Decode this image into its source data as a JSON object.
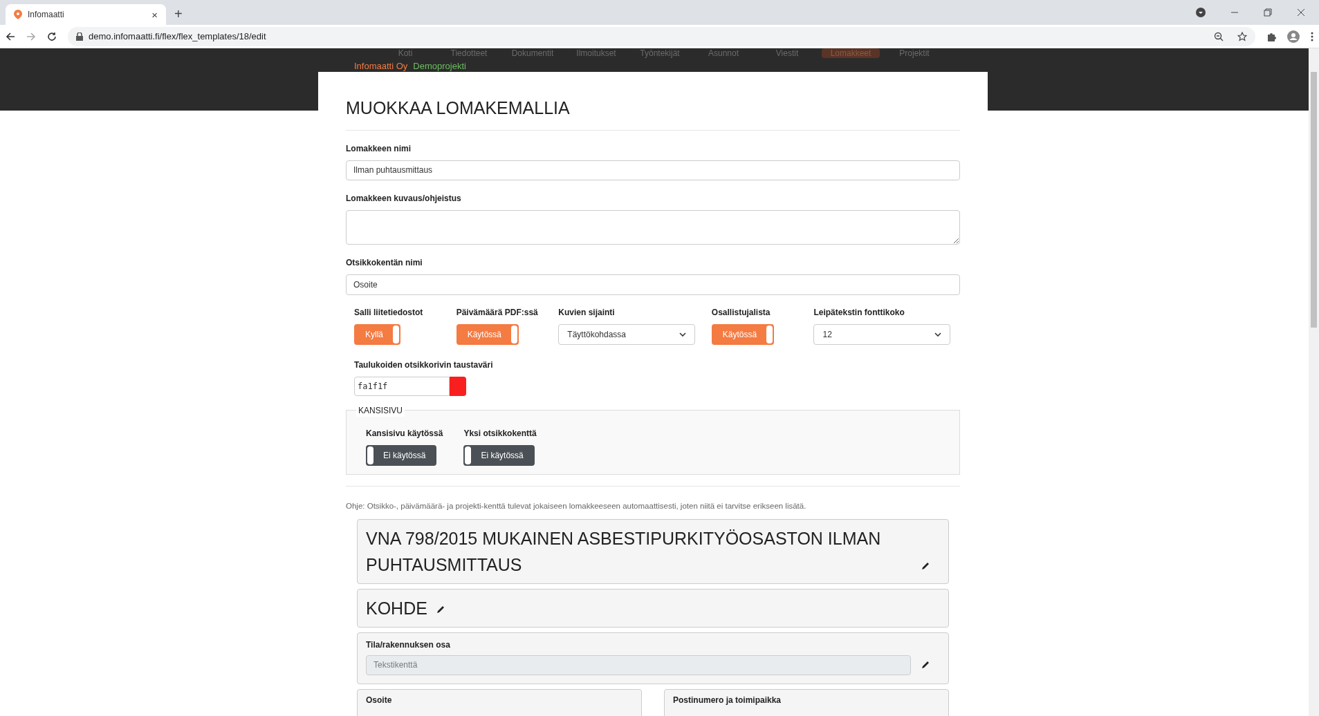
{
  "browser": {
    "tab_title": "Infomaatti",
    "tab_close": "×",
    "new_tab": "+",
    "url": "demo.infomaatti.fi/flex/flex_templates/18/edit"
  },
  "header": {
    "company": "Infomaatti Oy",
    "project": "Demoprojekti",
    "nav": [
      {
        "label": "Koti",
        "selected": false
      },
      {
        "label": "Tiedotteet",
        "selected": false
      },
      {
        "label": "Dokumentit",
        "selected": false
      },
      {
        "label": "Ilmoitukset",
        "selected": false
      },
      {
        "label": "Työntekijät",
        "selected": false
      },
      {
        "label": "Asunnot",
        "selected": false
      },
      {
        "label": "Viestit",
        "selected": false
      },
      {
        "label": "Lomakkeet",
        "selected": true
      },
      {
        "label": "Projektit",
        "selected": false
      }
    ]
  },
  "form": {
    "title": "MUOKKAA LOMAKEMALLIA",
    "name": {
      "label": "Lomakkeen nimi",
      "value": "Ilman puhtausmittaus"
    },
    "description": {
      "label": "Lomakkeen kuvaus/ohjeistus"
    },
    "header_field": {
      "label": "Otsikkokentän nimi",
      "value": "Osoite"
    },
    "settings": [
      {
        "kind": "switch",
        "label": "Salli liitetiedostot",
        "text": "Kyllä",
        "on": true
      },
      {
        "kind": "switch",
        "label": "Päivämäärä PDF:ssä",
        "text": "Käytössä",
        "on": true
      },
      {
        "kind": "select",
        "label": "Kuvien sijainti",
        "value": "Täyttökohdassa"
      },
      {
        "kind": "switch",
        "label": "Osallistujalista",
        "text": "Käytössä",
        "on": true
      },
      {
        "kind": "select",
        "label": "Leipätekstin fonttikoko",
        "value": "12"
      }
    ],
    "table_header_color": {
      "label": "Taulukoiden otsikkorivin taustaväri",
      "value": "fa1f1f",
      "color": "#fa1f1f"
    },
    "cover_page": {
      "legend": "KANSISIVU",
      "settings": [
        {
          "kind": "switch",
          "label": "Kansisivu käytössä",
          "text": "Ei käytössä",
          "on": false
        },
        {
          "kind": "switch",
          "label": "Yksi otsikkokenttä",
          "text": "Ei käytössä",
          "on": false
        }
      ]
    },
    "hint": "Ohje: Otsikko-, päivämäärä- ja projekti-kenttä tulevat jokaiseen lomakkeeseen automaattisesti, joten niitä ei tarvitse erikseen lisätä.",
    "blocks": [
      {
        "kind": "heading",
        "text": "VNA 798/2015 MUKAINEN ASBESTIPURKITYÖOSASTON ILMAN PUHTAUSMITTAUS"
      },
      {
        "kind": "heading",
        "text": "KOHDE"
      },
      {
        "kind": "text-field",
        "label": "Tila/rakennuksen osa",
        "placeholder": "Tekstikenttä"
      }
    ],
    "half_blocks": [
      {
        "label": "Osoite"
      },
      {
        "label": "Postinumero ja toimipaikka"
      }
    ]
  }
}
